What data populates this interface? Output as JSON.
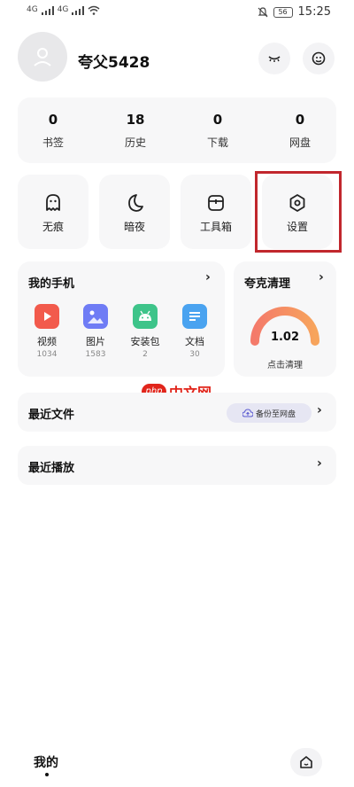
{
  "status_bar": {
    "left_signal_1": "4G",
    "left_signal_2": "4G",
    "battery": "56",
    "time": "15:25"
  },
  "profile": {
    "username": "夸父5428"
  },
  "stats": [
    {
      "value": "0",
      "label": "书签"
    },
    {
      "value": "18",
      "label": "历史"
    },
    {
      "value": "0",
      "label": "下载"
    },
    {
      "value": "0",
      "label": "网盘"
    }
  ],
  "tools": [
    {
      "label": "无痕"
    },
    {
      "label": "暗夜"
    },
    {
      "label": "工具箱"
    },
    {
      "label": "设置"
    }
  ],
  "my_phone": {
    "title": "我的手机",
    "chevron": "›",
    "items": [
      {
        "label": "视频",
        "count": "1034",
        "color": "#f25a4c"
      },
      {
        "label": "图片",
        "count": "1583",
        "color": "#6f7cf5"
      },
      {
        "label": "安装包",
        "count": "2",
        "color": "#3ec48a"
      },
      {
        "label": "文档",
        "count": "30",
        "color": "#4aa3f0"
      }
    ]
  },
  "cleaner": {
    "title": "夸克清理",
    "chevron": "›",
    "value": "1.02",
    "action": "点击清理"
  },
  "watermark": {
    "logo": "php",
    "text": "中文网"
  },
  "recent_files": {
    "title": "最近文件",
    "backup_label": "备份至网盘",
    "chevron": "›"
  },
  "recent_play": {
    "title": "最近播放",
    "chevron": "›"
  },
  "bottom_nav": {
    "tab_label": "我的"
  }
}
